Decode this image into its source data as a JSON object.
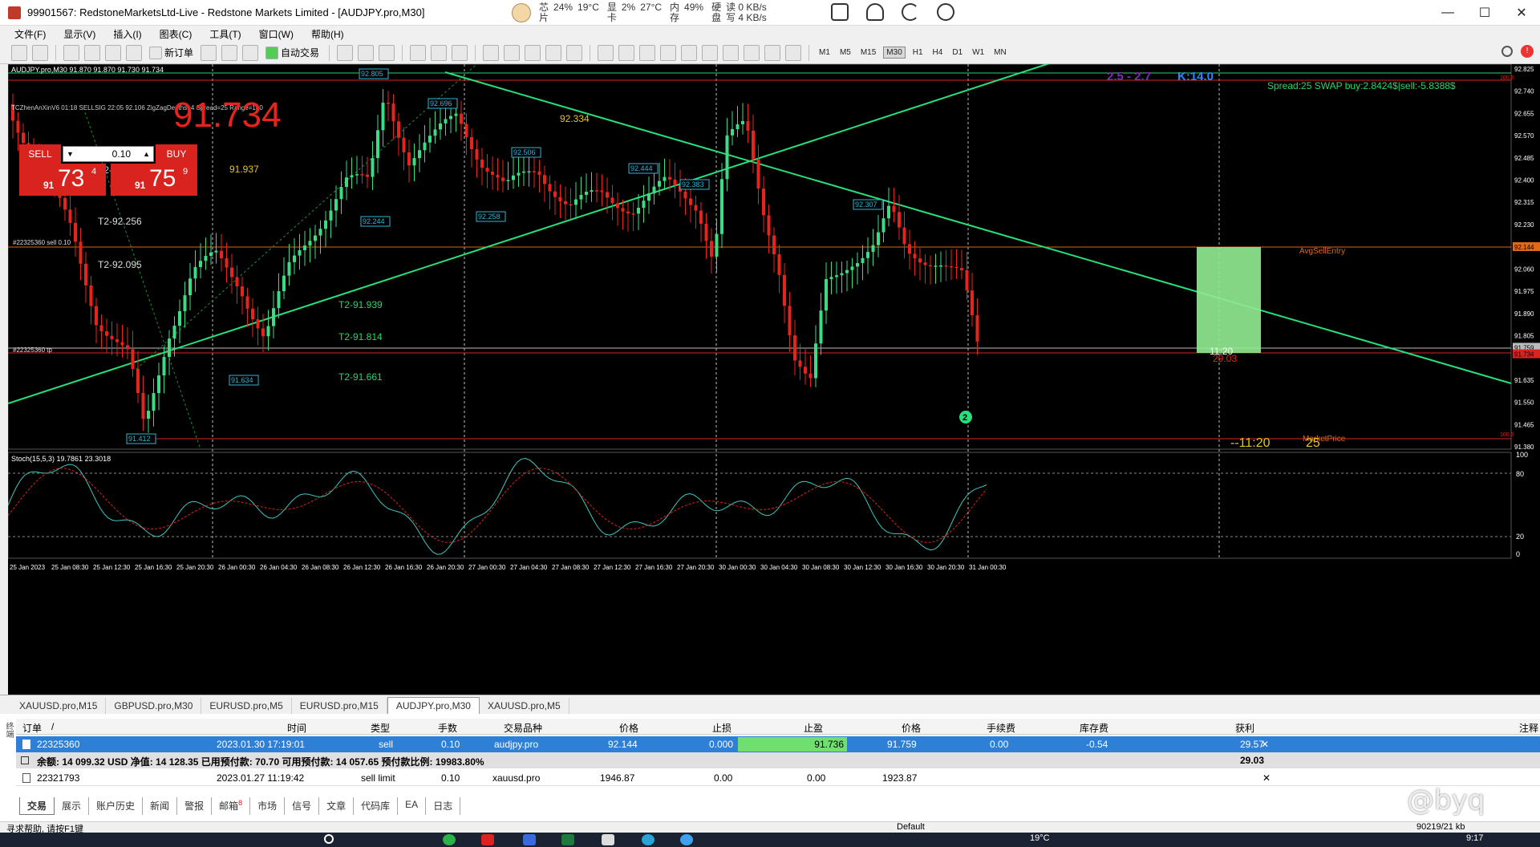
{
  "window": {
    "title": "99901567: RedstoneMarketsLtd-Live - Redstone Markets Limited - [AUDJPY.pro,M30]",
    "minimize": "—",
    "maximize": "☐",
    "close": "✕"
  },
  "sysmon": {
    "cpu_label": "芯",
    "cpu_value": "24%",
    "cpu_temp": "19°C",
    "cpu_label2": "片",
    "gpu_label": "显",
    "gpu_value": "2%",
    "gpu_temp": "27°C",
    "gpu_label2": "卡",
    "mem_label": "内",
    "mem_value": "49%",
    "mem_label2": "存",
    "disk_label": "硬",
    "disk_read": "读 0 KB/s",
    "disk_label2": "盘",
    "disk_write": "写 4 KB/s"
  },
  "menu": [
    "文件(F)",
    "显示(V)",
    "插入(I)",
    "图表(C)",
    "工具(T)",
    "窗口(W)",
    "帮助(H)"
  ],
  "toolbar": {
    "new_order": "新订单",
    "auto_trade": "自动交易",
    "timeframes": [
      "M1",
      "M5",
      "M15",
      "M30",
      "H1",
      "H4",
      "D1",
      "W1",
      "MN"
    ],
    "active_tf": "M30"
  },
  "chart": {
    "symbol_line": "AUDJPY.pro,M30  91.870 91.870 91.730 91.734",
    "one_click": {
      "sell": "SELL",
      "buy": "BUY",
      "lot": "0.10",
      "sell_prefix": "91",
      "sell_big": "73",
      "sell_sup": "4",
      "buy_prefix": "91",
      "buy_big": "75",
      "buy_sup": "9"
    },
    "indicator_line": "TCZhenAnXinV6 01:18 SELLSIG 22:05 92.106 ZigZagDepths=4 Spread=25 Range=140",
    "big_price": "91.734",
    "ratio_label": "2.5 - 2.7",
    "k_label": "K:14.0",
    "spread_info": "Spread:25  SWAP buy:2.8424$|sell:-5.8388$",
    "zigzag_labels": [
      {
        "text": "92.805"
      },
      {
        "text": "92.696"
      },
      {
        "text": "92.506"
      },
      {
        "text": "92.444"
      },
      {
        "text": "92.383"
      },
      {
        "text": "92.307"
      },
      {
        "text": "92.258"
      },
      {
        "text": "92.244"
      },
      {
        "text": "91.634"
      },
      {
        "text": "91.412"
      }
    ],
    "text_labels": [
      {
        "text": "92.334"
      },
      {
        "text": "91.937"
      },
      {
        "text": "T2-92.455"
      },
      {
        "text": "T2-92.256"
      },
      {
        "text": "T2-92.095"
      },
      {
        "text": "T2-91.939"
      },
      {
        "text": "T2-91.814"
      },
      {
        "text": "T2-91.661"
      }
    ],
    "sell_line_label": "#22325360 sell 0.10",
    "tp_line_label": "#22325360 tp",
    "avg_sell_entry": "AvgSellEntry",
    "market_price": "MarketPrice",
    "box_profit": "29.03",
    "timer": "--11:20",
    "timer_small": "11:20",
    "spread_small": "25",
    "circle_num": "2",
    "price_axis": [
      "92.825",
      "92.740",
      "92.655",
      "92.570",
      "92.485",
      "92.400",
      "92.315",
      "92.230",
      "92.144",
      "92.060",
      "91.975",
      "91.890",
      "91.805",
      "91.759",
      "91.734",
      "91.635",
      "91.550",
      "91.465",
      "91.380"
    ],
    "level_tags": [
      "100.0",
      "100.0"
    ],
    "stoch_label": "Stoch(15,5,3) 19.7861 23.3018",
    "stoch_axis": [
      "100",
      "80",
      "20",
      "0"
    ],
    "time_axis": [
      "25 Jan 2023",
      "25 Jan 08:30",
      "25 Jan 12:30",
      "25 Jan 16:30",
      "25 Jan 20:30",
      "26 Jan 00:30",
      "26 Jan 04:30",
      "26 Jan 08:30",
      "26 Jan 12:30",
      "26 Jan 16:30",
      "26 Jan 20:30",
      "27 Jan 00:30",
      "27 Jan 04:30",
      "27 Jan 08:30",
      "27 Jan 12:30",
      "27 Jan 16:30",
      "27 Jan 20:30",
      "30 Jan 00:30",
      "30 Jan 04:30",
      "30 Jan 08:30",
      "30 Jan 12:30",
      "30 Jan 16:30",
      "30 Jan 20:30",
      "31 Jan 00:30"
    ]
  },
  "chart_tabs": [
    "XAUUSD.pro,M15",
    "GBPUSD.pro,M30",
    "EURUSD.pro,M5",
    "EURUSD.pro,M15",
    "AUDJPY.pro,M30",
    "XAUUSD.pro,M5"
  ],
  "active_chart_tab": "AUDJPY.pro,M30",
  "terminal": {
    "headers": [
      "订单",
      "/",
      "时间",
      "类型",
      "手数",
      "交易品种",
      "价格",
      "止损",
      "止盈",
      "价格",
      "手续费",
      "库存费",
      "获利",
      "注释"
    ],
    "position": {
      "order": "22325360",
      "time": "2023.01.30 17:19:01",
      "type": "sell",
      "lots": "0.10",
      "symbol": "audjpy.pro",
      "open_price": "92.144",
      "sl": "0.000",
      "tp": "91.736",
      "price": "91.759",
      "commission": "0.00",
      "swap": "-0.54",
      "profit": "29.57"
    },
    "balance_line": "余额: 14 099.32 USD  净值: 14 128.35  已用预付款: 70.70  可用预付款: 14 057.65  预付款比例: 19983.80%",
    "balance_profit": "29.03",
    "pending": {
      "order": "22321793",
      "time": "2023.01.27 11:19:42",
      "type": "sell limit",
      "lots": "0.10",
      "symbol": "xauusd.pro",
      "open_price": "1946.87",
      "sl": "0.00",
      "tp": "0.00",
      "price": "1923.87"
    },
    "tabs": [
      "交易",
      "展示",
      "账户历史",
      "新闻",
      "警报",
      "邮箱",
      "市场",
      "信号",
      "文章",
      "代码库",
      "EA",
      "日志"
    ],
    "active_tab": "交易",
    "mail_badge": "8",
    "side_label": "终端"
  },
  "status": {
    "help": "寻求帮助, 请按F1键",
    "profile": "Default",
    "traffic": "90219/21 kb"
  },
  "taskbar": {
    "temp": "19°C",
    "time": "9:17"
  },
  "watermark": "@byq",
  "colors": {
    "sell_red": "#d9231e",
    "candle_up": "#3ddc84",
    "candle_down": "#e8231c",
    "trend": "#27e07a",
    "selection": "#2e7fd6",
    "tp_cell": "#6fe06f"
  }
}
